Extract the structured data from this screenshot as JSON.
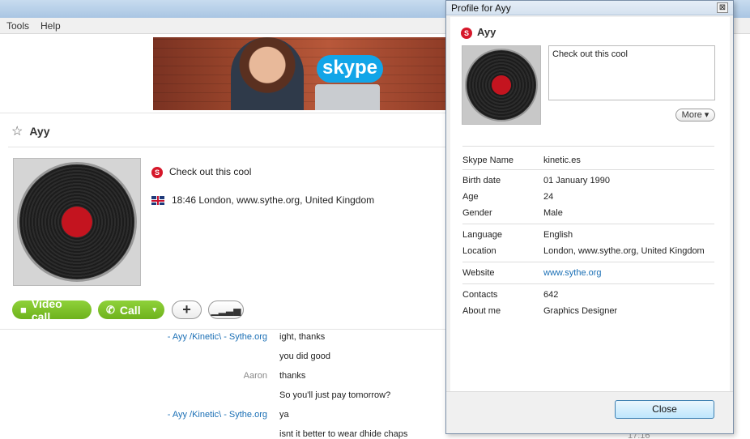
{
  "menu": {
    "tools": "Tools",
    "help": "Help"
  },
  "banner": {
    "logo": "skype"
  },
  "contact": {
    "name": "Ayy",
    "mood": "Check out this cool",
    "location_line": "18:46 London, www.sythe.org, United Kingdom",
    "buttons": {
      "video_call": "Video call",
      "call": "Call",
      "add": "+",
      "dd": "▾"
    }
  },
  "chat": [
    {
      "who": "- Ayy /Kinetic\\ - Sythe.org",
      "msg": "ight, thanks"
    },
    {
      "who": "",
      "msg": "you did good"
    },
    {
      "who": "Aaron",
      "msg": "thanks"
    },
    {
      "who": "",
      "msg": "So you'll just pay tomorrow?"
    },
    {
      "who": "- Ayy /Kinetic\\ - Sythe.org",
      "msg": "ya"
    },
    {
      "who": "",
      "msg": "isnt it better to wear dhide chaps"
    }
  ],
  "chat_time": "17:16",
  "profile": {
    "title": "Profile for Ayy",
    "close_x": "⊠",
    "name": "Ayy",
    "mood": "Check out this cool",
    "more": "More",
    "fields": {
      "skype_name": {
        "label": "Skype Name",
        "value": "kinetic.es"
      },
      "birth_date": {
        "label": "Birth date",
        "value": "01 January 1990"
      },
      "age": {
        "label": "Age",
        "value": "24"
      },
      "gender": {
        "label": "Gender",
        "value": "Male"
      },
      "language": {
        "label": "Language",
        "value": "English"
      },
      "location": {
        "label": "Location",
        "value": "London, www.sythe.org, United Kingdom"
      },
      "website": {
        "label": "Website",
        "value": "www.sythe.org"
      },
      "contacts": {
        "label": "Contacts",
        "value": "642"
      },
      "about_me": {
        "label": "About me",
        "value": "Graphics Designer"
      }
    },
    "close_button": "Close"
  },
  "icons": {
    "star": "☆",
    "video": "■",
    "phone": "✆",
    "bars": "▁▂▃▅"
  }
}
